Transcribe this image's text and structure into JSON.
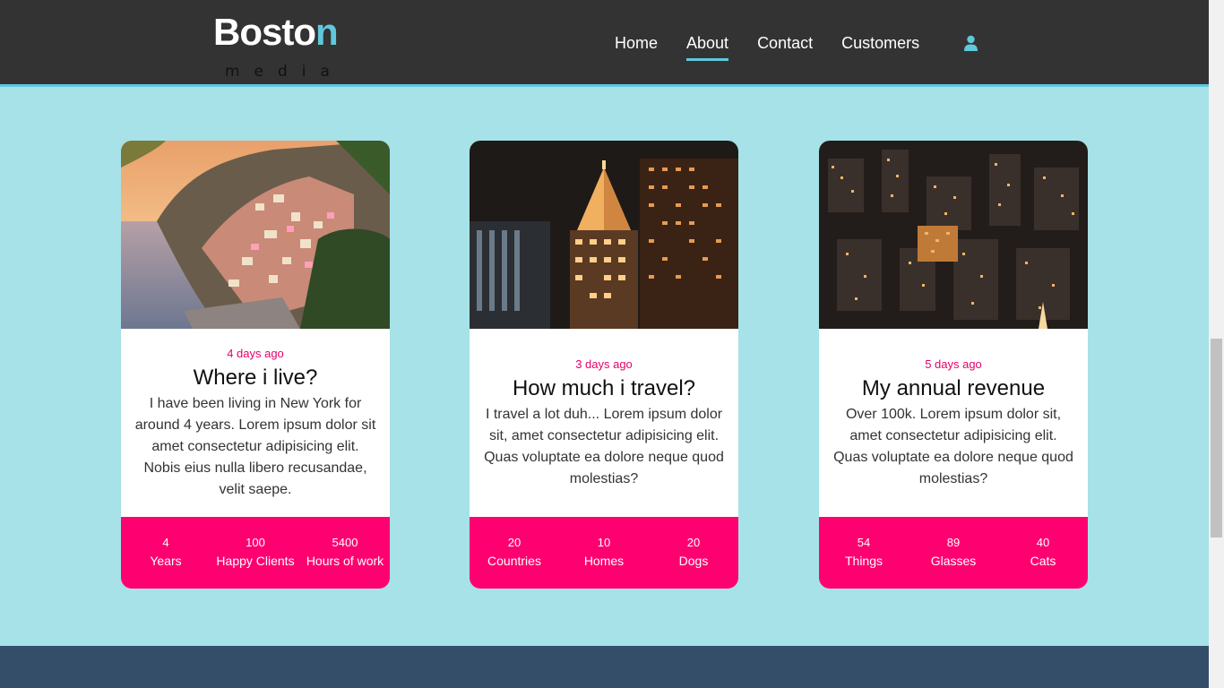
{
  "brand": {
    "main_prefix": "Bosto",
    "main_accent": "n",
    "sub": "media"
  },
  "nav": {
    "items": [
      {
        "label": "Home"
      },
      {
        "label": "About",
        "active": true
      },
      {
        "label": "Contact"
      },
      {
        "label": "Customers"
      }
    ],
    "user_icon": "user-icon"
  },
  "colors": {
    "header_bg": "#333333",
    "accent": "#5fc8dd",
    "page_bg": "#a6e2e8",
    "stats_bg": "#ff0070",
    "date_color": "#e8006a",
    "footer_bg": "#344e6a"
  },
  "cards": [
    {
      "image": "coastal-town-photo",
      "date": "4 days ago",
      "title": "Where i live?",
      "text": "I have been living in New York for around 4 years. Lorem ipsum dolor sit amet consectetur adipisicing elit. Nobis eius nulla libero recusandae, velit saepe.",
      "stats": [
        {
          "value": "4",
          "label": "Years"
        },
        {
          "value": "100",
          "label": "Happy Clients"
        },
        {
          "value": "5400",
          "label": "Hours of work"
        }
      ]
    },
    {
      "image": "night-skyscrapers-photo",
      "date": "3 days ago",
      "title": "How much i travel?",
      "text": "I travel a lot duh... Lorem ipsum dolor sit, amet consectetur adipisicing elit. Quas voluptate ea dolore neque quod molestias?",
      "stats": [
        {
          "value": "20",
          "label": "Countries"
        },
        {
          "value": "10",
          "label": "Homes"
        },
        {
          "value": "20",
          "label": "Dogs"
        }
      ]
    },
    {
      "image": "city-night-aerial-photo",
      "date": "5 days ago",
      "title": "My annual revenue",
      "text": "Over 100k. Lorem ipsum dolor sit, amet consectetur adipisicing elit. Quas voluptate ea dolore neque quod molestias?",
      "stats": [
        {
          "value": "54",
          "label": "Things"
        },
        {
          "value": "89",
          "label": "Glasses"
        },
        {
          "value": "40",
          "label": "Cats"
        }
      ]
    }
  ]
}
